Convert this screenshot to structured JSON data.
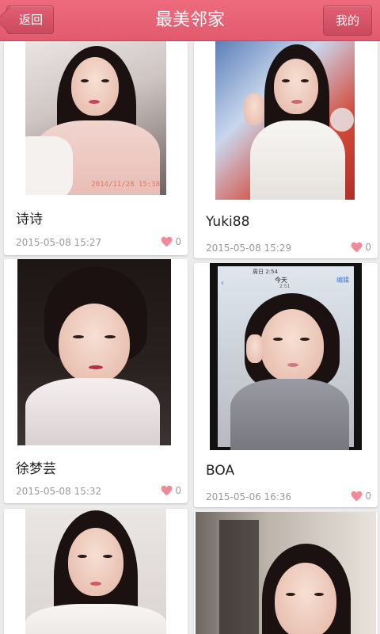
{
  "header": {
    "title": "最美邻家",
    "back_label": "返回",
    "me_label": "我的"
  },
  "cards": [
    {
      "name": "诗诗",
      "date": "2015-05-08 15:27",
      "likes": "0",
      "photo_stamp": "2014/11/28 15:38"
    },
    {
      "name": "Yuki88",
      "date": "2015-05-08 15:29",
      "likes": "0"
    },
    {
      "name": "徐梦芸",
      "date": "2015-05-08 15:32",
      "likes": "0"
    },
    {
      "name": "BOA",
      "date": "2015-05-06 16:36",
      "likes": "0",
      "phone_status": "周日 2:54",
      "phone_today": "今天",
      "phone_edit": "编辑",
      "phone_time": "2:51"
    },
    {
      "name": "",
      "date": "",
      "likes": ""
    },
    {
      "name": "",
      "date": "",
      "likes": ""
    }
  ],
  "colors": {
    "accent": "#e25a6e",
    "heart": "#f08a98"
  }
}
